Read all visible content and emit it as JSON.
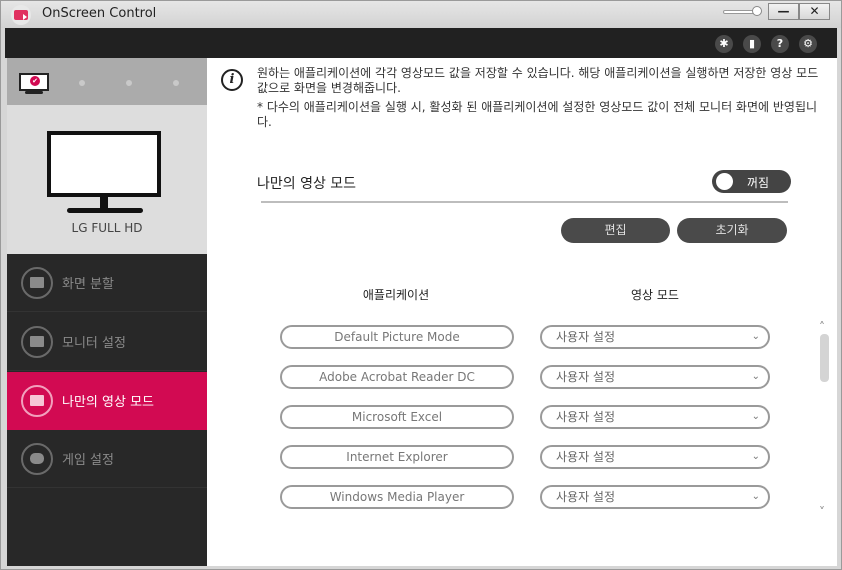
{
  "window": {
    "title": "OnScreen Control",
    "minimize_label": "—",
    "close_label": "✕"
  },
  "toolbar": {
    "icons": [
      {
        "name": "cursor-icon",
        "glyph": "✱"
      },
      {
        "name": "screen-icon",
        "glyph": "▮"
      },
      {
        "name": "help-icon",
        "glyph": "?"
      },
      {
        "name": "settings-icon",
        "glyph": "⚙"
      }
    ]
  },
  "sidebar": {
    "monitor_label": "LG FULL HD",
    "monitor_check": "✔",
    "items": [
      {
        "label": "화면 분할",
        "icon": "split-screen-icon",
        "active": false
      },
      {
        "label": "모니터 설정",
        "icon": "monitor-settings-icon",
        "active": false
      },
      {
        "label": "나만의 영상 모드",
        "icon": "my-picture-mode-icon",
        "active": true
      },
      {
        "label": "게임 설정",
        "icon": "gamepad-icon",
        "active": false
      }
    ]
  },
  "info": {
    "icon": "i",
    "line1": "원하는 애플리케이션에 각각 영상모드 값을 저장할 수 있습니다. 해당 애플리케이션을 실행하면 저장한 영상 모드 값으로 화면을 변경해줍니다.",
    "line2": "* 다수의 애플리케이션을 실행 시, 활성화 된 애플리케이션에 설정한 영상모드 값이 전체 모니터 화면에 반영됩니다."
  },
  "mode_section": {
    "title": "나만의 영상 모드",
    "toggle_label": "꺼짐",
    "toggle_on": false,
    "edit_label": "편집",
    "reset_label": "초기화"
  },
  "table": {
    "headers": {
      "app": "애플리케이션",
      "mode": "영상 모드"
    },
    "rows": [
      {
        "app": "Default Picture Mode",
        "mode": "사용자 설정"
      },
      {
        "app": "Adobe Acrobat Reader DC",
        "mode": "사용자 설정"
      },
      {
        "app": "Microsoft Excel",
        "mode": "사용자 설정"
      },
      {
        "app": "Internet Explorer",
        "mode": "사용자 설정"
      },
      {
        "app": "Windows Media Player",
        "mode": "사용자 설정"
      }
    ],
    "chevron": "⌄"
  },
  "scrollbar": {
    "up": "˄",
    "down": "˅"
  }
}
